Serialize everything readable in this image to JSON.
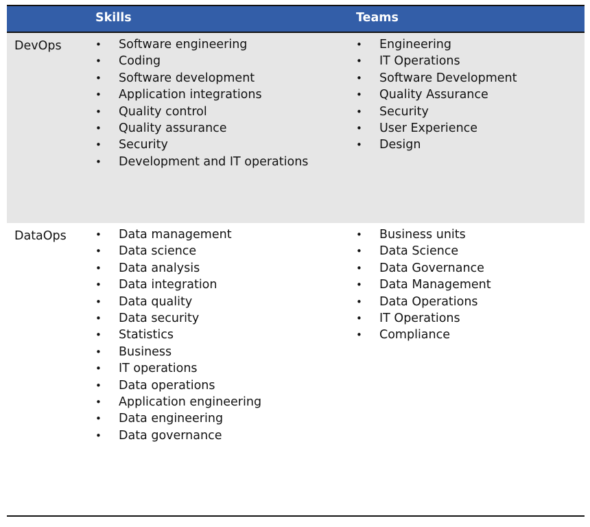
{
  "header": {
    "col0": "",
    "col1": "Skills",
    "col2": "Teams"
  },
  "colors": {
    "header_bg": "#335ea8",
    "header_text": "#ffffff",
    "row_shade": "#e6e6e6"
  },
  "rows": [
    {
      "label": "DevOps",
      "skills": [
        "Software engineering",
        "Coding",
        "Software development",
        "Application integrations",
        "Quality control",
        "Quality assurance",
        "Security",
        "Development and IT operations"
      ],
      "teams": [
        "Engineering",
        "IT Operations",
        "Software Development",
        "Quality Assurance",
        "Security",
        "User Experience",
        "Design"
      ]
    },
    {
      "label": "DataOps",
      "skills": [
        "Data management",
        "Data science",
        "Data analysis",
        "Data integration",
        "Data quality",
        "Data security",
        "Statistics",
        "Business",
        "IT operations",
        "Data operations",
        "Application engineering",
        "Data engineering",
        "Data governance"
      ],
      "teams": [
        "Business units",
        "Data Science",
        "Data Governance",
        "Data Management",
        "Data Operations",
        "IT Operations",
        "Compliance"
      ]
    }
  ]
}
